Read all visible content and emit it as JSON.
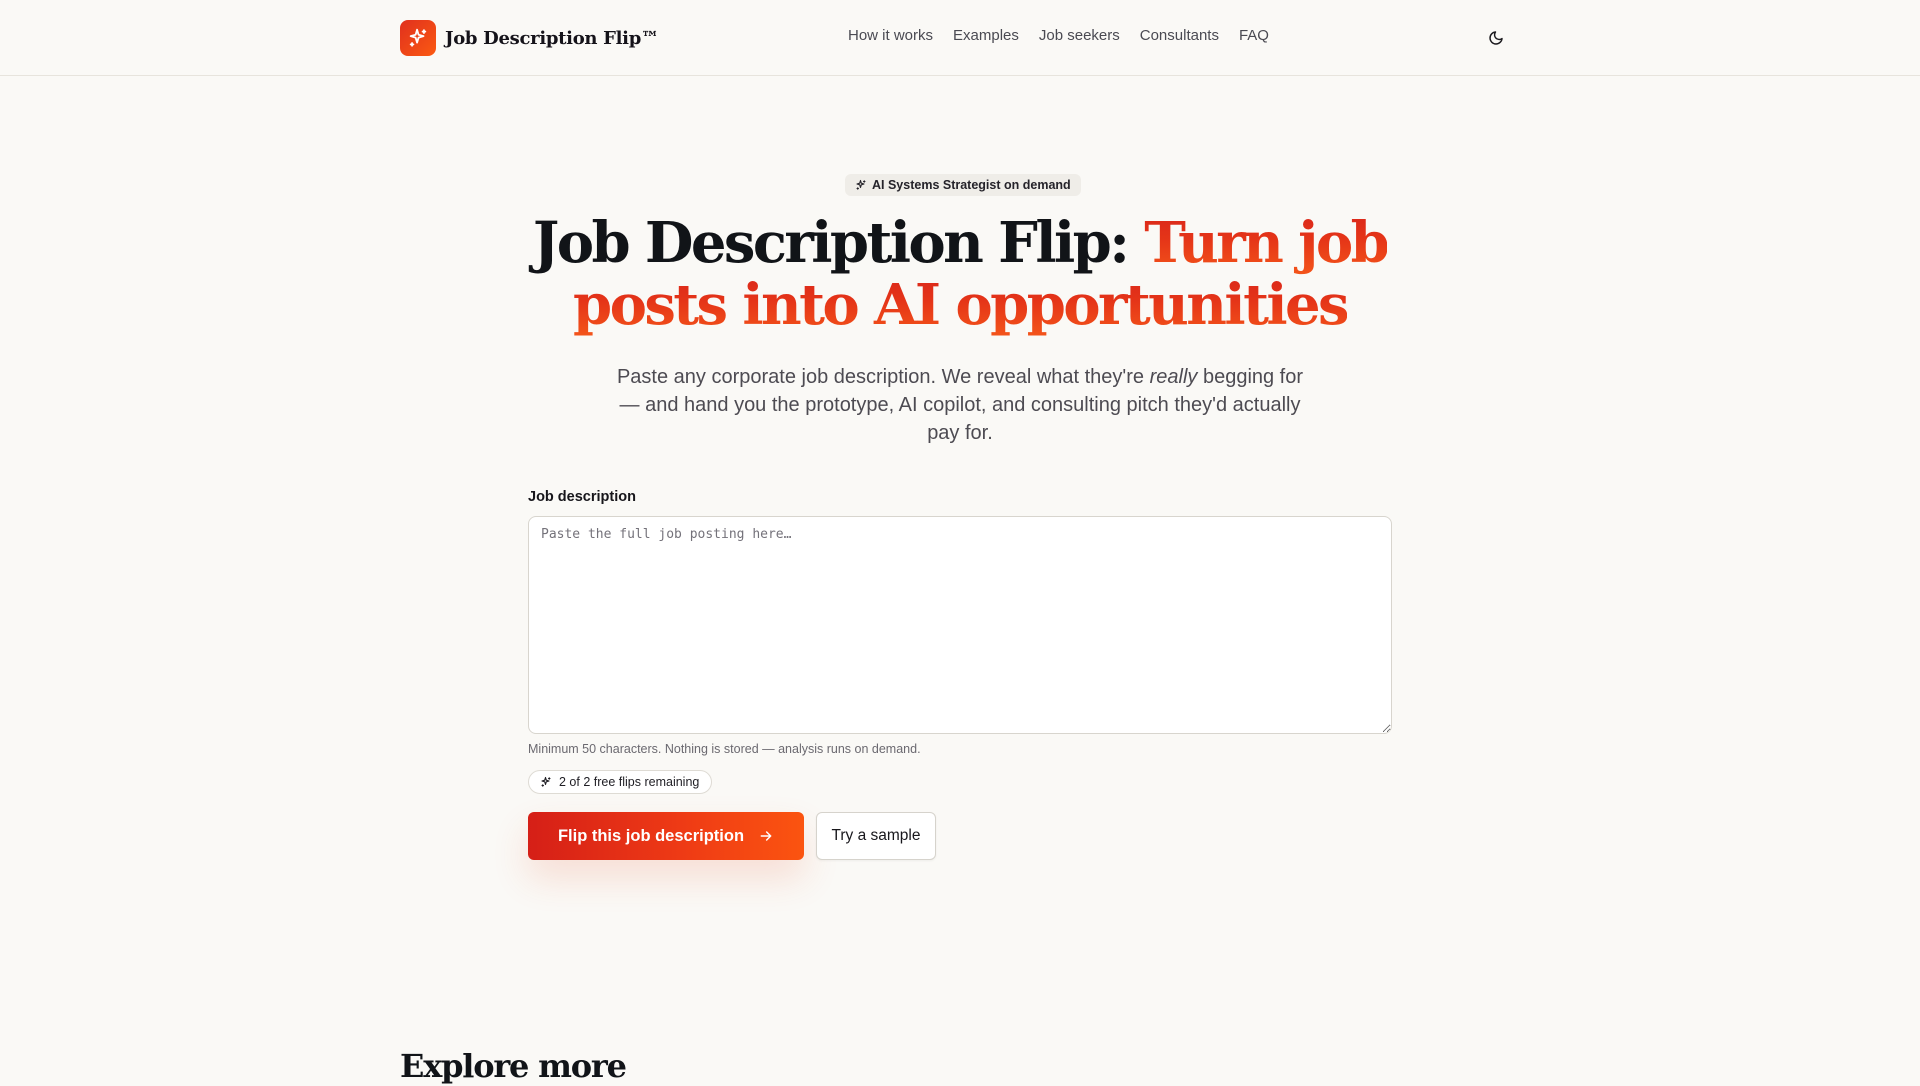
{
  "brand": {
    "name": "Job Description Flip™",
    "logo_icon": "sparkles-icon",
    "accent_color": "#e8331c"
  },
  "nav": {
    "items": [
      {
        "label": "How it works"
      },
      {
        "label": "Examples"
      },
      {
        "label": "Job seekers"
      },
      {
        "label": "Consultants"
      },
      {
        "label": "FAQ"
      }
    ],
    "theme_toggle_icon": "moon-icon"
  },
  "hero": {
    "badge": "AI Systems Strategist on demand",
    "title_main": "Job Description Flip: ",
    "title_accent": "Turn job posts into AI opportunities",
    "subtitle_before": "Paste any corporate job description. We reveal what they're ",
    "subtitle_emphasis": "really",
    "subtitle_after": " begging for — and hand you the prototype, AI copilot, and consulting pitch they'd actually pay for."
  },
  "form": {
    "label": "Job description",
    "placeholder": "Paste the full job posting here…",
    "value": "",
    "hint": "Minimum 50 characters. Nothing is stored — analysis runs on demand.",
    "quota": "2 of 2 free flips remaining",
    "primary_button": "Flip this job description",
    "secondary_button": "Try a sample"
  },
  "sections": {
    "explore_title": "Explore more"
  },
  "colors": {
    "background": "#faf9f6",
    "primary_gradient_start": "#d51f17",
    "primary_gradient_end": "#fb5410",
    "heading": "#111418"
  }
}
